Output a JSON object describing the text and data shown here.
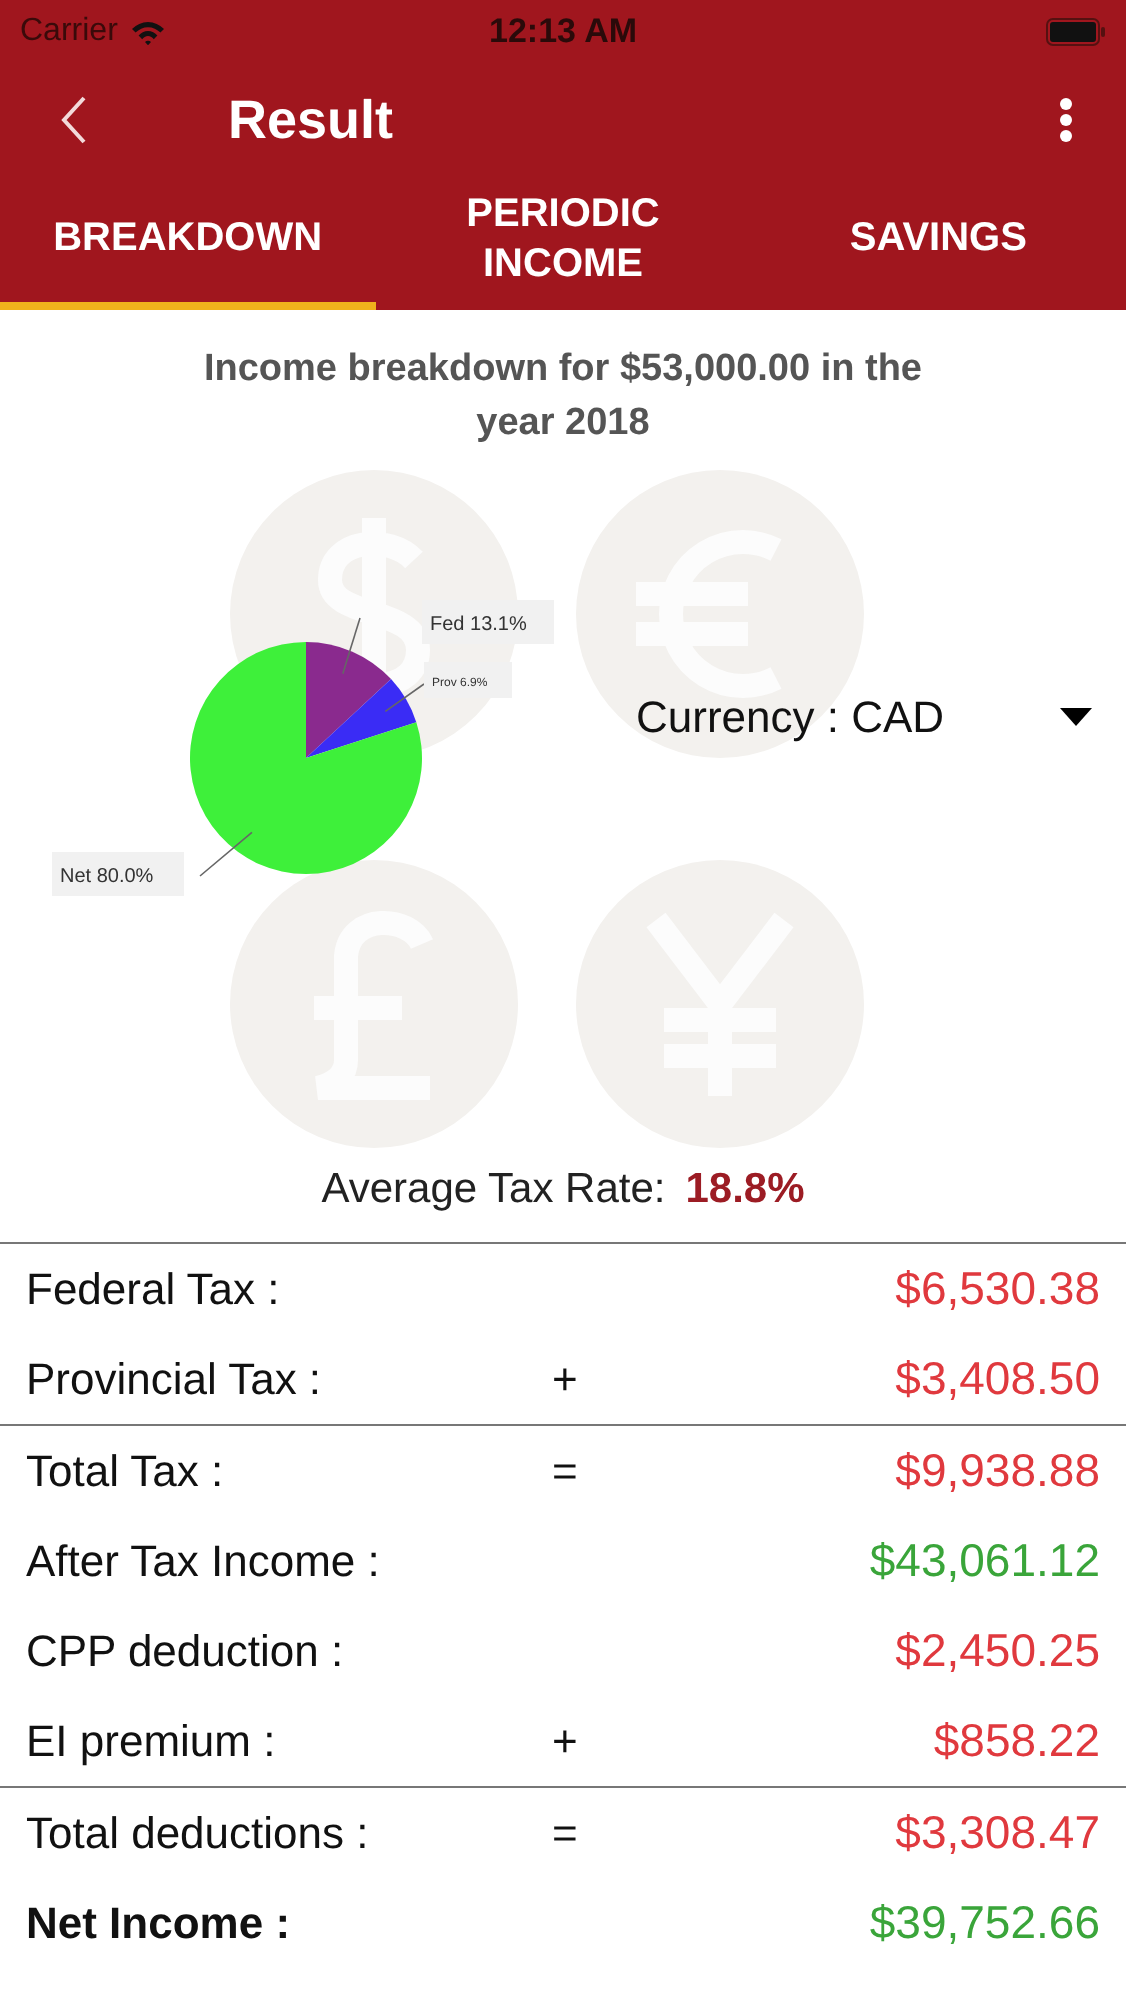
{
  "status_bar": {
    "carrier": "Carrier",
    "time": "12:13 AM"
  },
  "nav": {
    "title": "Result"
  },
  "tabs": [
    {
      "label": "BREAKDOWN",
      "selected": true
    },
    {
      "label": "PERIODIC INCOME",
      "selected": false
    },
    {
      "label": "SAVINGS",
      "selected": false
    }
  ],
  "heading": "Income breakdown for $53,000.00 in the year 2018",
  "chart_data": {
    "type": "pie",
    "categories": [
      "Fed",
      "Prov",
      "Net"
    ],
    "values": [
      13.1,
      6.9,
      80.0
    ],
    "colors": [
      "#8a2a8e",
      "#3a2cf5",
      "#3ef03a"
    ],
    "value_labels": [
      "13.1%",
      "6.9%",
      "80.0%"
    ]
  },
  "currency": {
    "label": "Currency : CAD"
  },
  "average_tax_rate": {
    "label": "Average Tax Rate:",
    "value": "18.8%"
  },
  "rows": [
    {
      "label": "Federal Tax :",
      "operator": "",
      "value": "$6,530.38",
      "kind": "deduction",
      "bold": false,
      "separator_above": true
    },
    {
      "label": "Provincial Tax :",
      "operator": "+",
      "value": "$3,408.50",
      "kind": "deduction",
      "bold": false,
      "separator_above": false
    },
    {
      "label": "Total Tax :",
      "operator": "=",
      "value": "$9,938.88",
      "kind": "deduction",
      "bold": false,
      "separator_above": true
    },
    {
      "label": "After Tax Income :",
      "operator": "",
      "value": "$43,061.12",
      "kind": "income",
      "bold": false,
      "separator_above": false
    },
    {
      "label": "CPP deduction :",
      "operator": "",
      "value": "$2,450.25",
      "kind": "deduction",
      "bold": false,
      "separator_above": false
    },
    {
      "label": "EI premium :",
      "operator": "+",
      "value": "$858.22",
      "kind": "deduction",
      "bold": false,
      "separator_above": false
    },
    {
      "label": "Total deductions :",
      "operator": "=",
      "value": "$3,308.47",
      "kind": "deduction",
      "bold": false,
      "separator_above": true
    },
    {
      "label": "Net Income :",
      "operator": "",
      "value": "$39,752.66",
      "kind": "income",
      "bold": true,
      "separator_above": false
    }
  ]
}
